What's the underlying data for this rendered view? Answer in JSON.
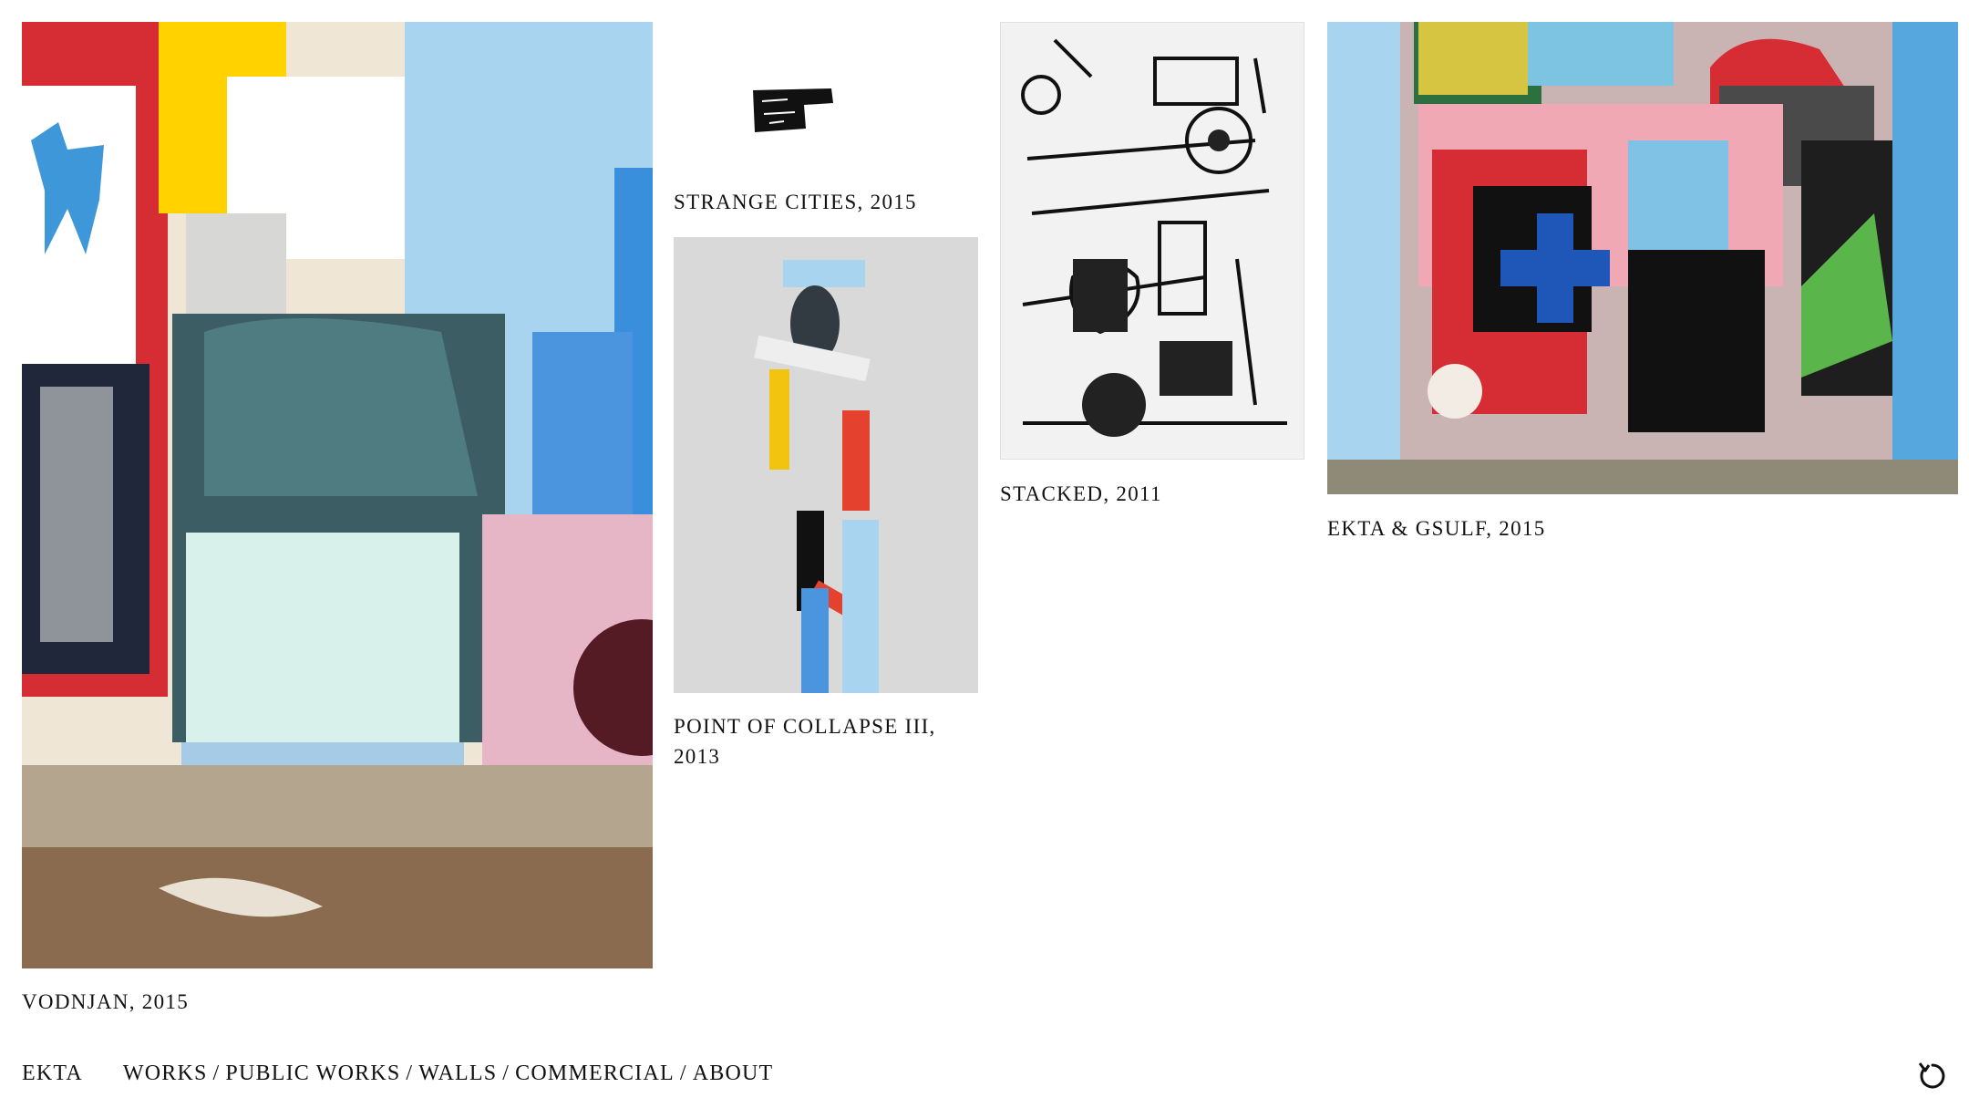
{
  "brand": "EKTA",
  "nav": [
    {
      "label": "WORKS"
    },
    {
      "label": "PUBLIC WORKS"
    },
    {
      "label": "WALLS"
    },
    {
      "label": "COMMERCIAL"
    },
    {
      "label": "ABOUT"
    }
  ],
  "nav_separator": "/",
  "works": [
    {
      "id": "vodnjan",
      "title": "VODNJAN, 2015"
    },
    {
      "id": "strange",
      "title": "STRANGE CITIES, 2015"
    },
    {
      "id": "collapse",
      "title": "POINT OF COLLAPSE III, 2013"
    },
    {
      "id": "stacked",
      "title": "STACKED, 2011"
    },
    {
      "id": "ekta",
      "title": "EKTA & GSULF, 2015"
    }
  ],
  "icons": {
    "reload": "reload-icon"
  }
}
